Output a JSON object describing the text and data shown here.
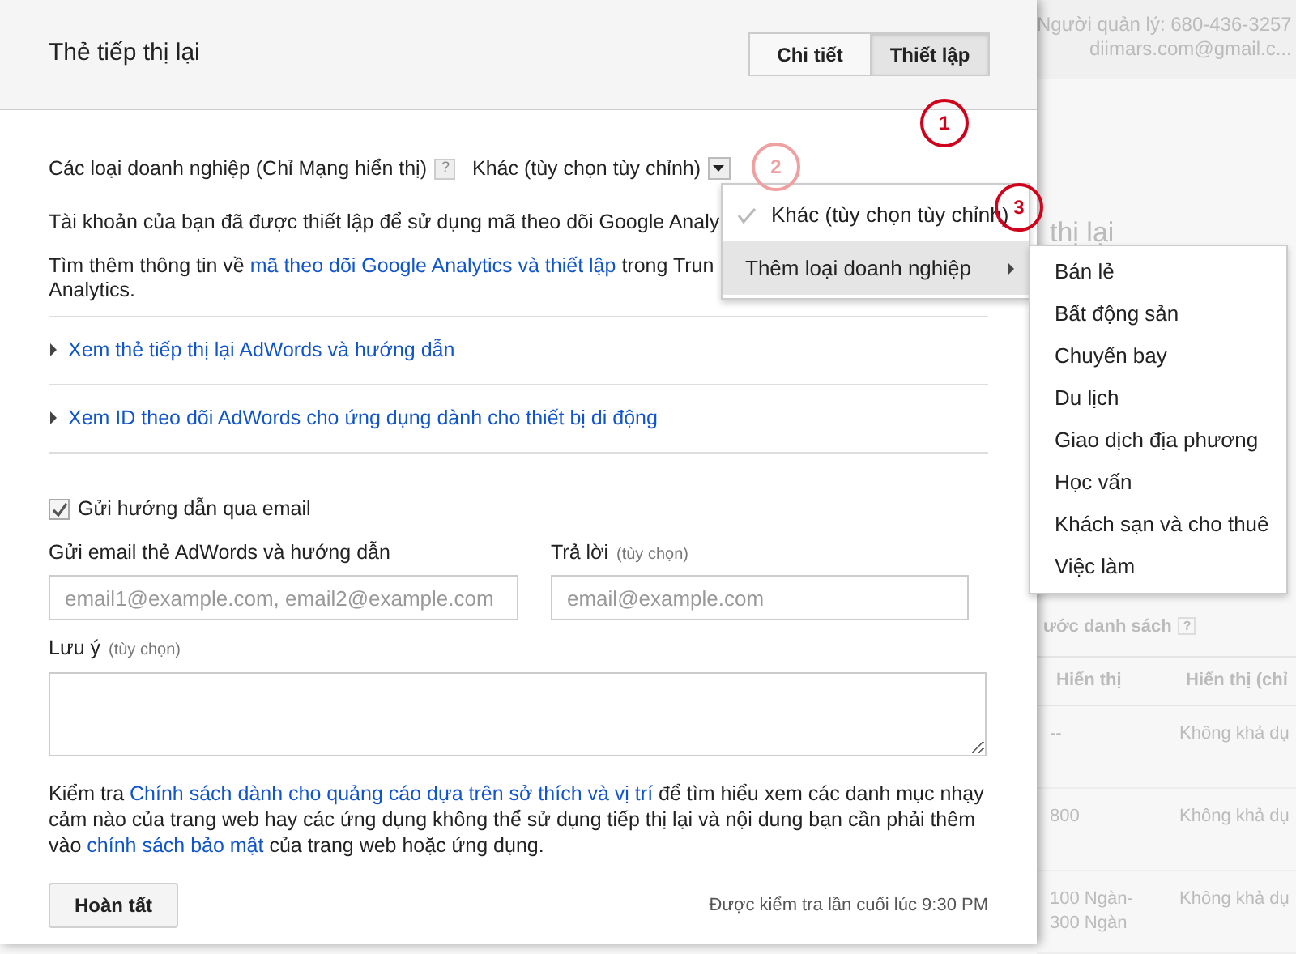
{
  "dialog": {
    "title": "Thẻ tiếp thị lại",
    "tabs": [
      {
        "label": "Chi tiết",
        "selected": false
      },
      {
        "label": "Thiết lập",
        "selected": true
      }
    ],
    "business_type": {
      "label": "Các loại doanh nghiệp (Chỉ Mạng hiển thị)",
      "help": "?",
      "value": "Khác (tùy chọn tùy chỉnh)"
    },
    "info_1": "Tài khoản của bạn đã được thiết lập để sử dụng mã theo dõi Google Analy",
    "info_2": {
      "before": "Tìm thêm thông tin về",
      "link": "mã theo dõi Google Analytics và thiết lập",
      "after": "trong Trun",
      "line_2": "Analytics."
    },
    "sections": [
      {
        "label": "Xem thẻ tiếp thị lại AdWords và hướng dẫn",
        "expanded": false
      },
      {
        "label": "Xem ID theo dõi AdWords cho ứng dụng dành cho thiết bị di động",
        "expanded": false
      }
    ],
    "email_instructions": {
      "label": "Gửi hướng dẫn qua email",
      "checked": true
    },
    "email_to": {
      "label": "Gửi email thẻ AdWords và hướng dẫn",
      "placeholder": "email1@example.com, email2@example.com"
    },
    "reply_to": {
      "label": "Trả lời",
      "hint": "(tùy chọn)",
      "placeholder": "email@example.com"
    },
    "note": {
      "label": "Lưu ý",
      "hint": "(tùy chọn)"
    },
    "policy": {
      "text_1": "Kiểm tra",
      "link_1": "Chính sách dành cho quảng cáo dựa trên sở thích và vị trí",
      "text_2": "để tìm hiểu xem các danh mục nhạy cảm nào của trang web hay các ứng dụng không thể sử dụng tiếp thị lại và nội dung bạn cần phải thêm vào",
      "link_2": "chính sách bảo mật",
      "text_3": "của trang web hoặc ứng dụng."
    },
    "done_button": "Hoàn tất",
    "last_checked": "Được kiểm tra lần cuối lúc 9:30 PM"
  },
  "menu": {
    "items": [
      {
        "label": "Khác (tùy chọn tùy chỉnh)",
        "checked": true,
        "selected": false
      },
      {
        "label": "Thêm loại doanh nghiệp",
        "checked": false,
        "selected": true
      }
    ],
    "submenu": [
      "Bán lẻ",
      "Bất động sản",
      "Chuyến bay",
      "Du lịch",
      "Giao dịch địa phương",
      "Học vấn",
      "Khách sạn và cho thuê",
      "Việc làm"
    ]
  },
  "annotations": [
    {
      "number": "1",
      "faded": false
    },
    {
      "number": "2",
      "faded": true
    },
    {
      "number": "3",
      "faded": false
    }
  ],
  "background": {
    "manager": "Người quản lý: 680-436-3257",
    "email": "diimars.com@gmail.c...",
    "title": "thị lại",
    "list_label": "ước danh sách",
    "help": "?",
    "columns": [
      "Hiển thị",
      "Hiển thị (chỉ"
    ],
    "rows": [
      [
        "--",
        "Không khả dụ"
      ],
      [
        "800",
        "Không khả dụ"
      ],
      [
        "100 Ngàn-\n300 Ngàn",
        "Không khả dụ"
      ]
    ]
  }
}
